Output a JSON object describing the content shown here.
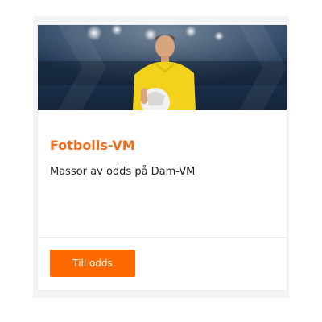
{
  "card": {
    "image_alt": "football-player-photo",
    "title": "Fotbolls-VM",
    "description": "Massor av odds på Dam-VM",
    "button_label": "Till odds"
  },
  "colors": {
    "accent": "#f26b1d",
    "button": "#ff6a00",
    "hero_bg": "#1f3752",
    "jersey": "#f2d21a"
  }
}
